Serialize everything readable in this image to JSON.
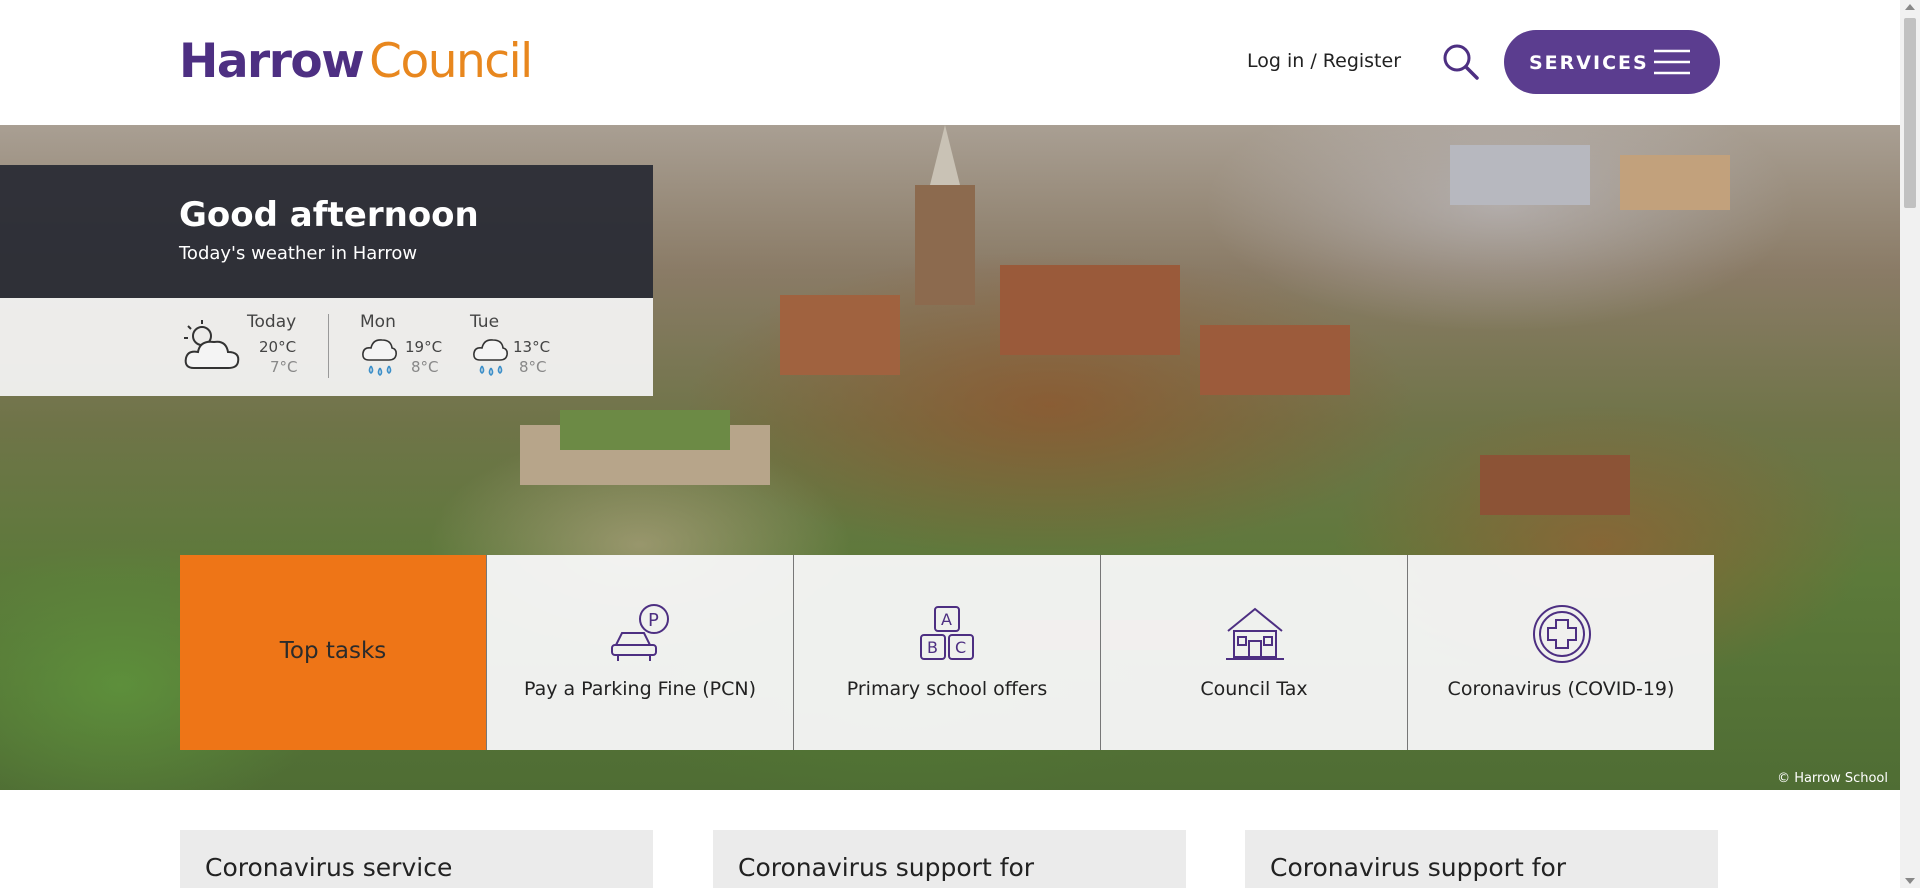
{
  "header": {
    "logo_primary": "Harrow",
    "logo_secondary": "Council",
    "login_label": "Log in / Register",
    "services_label": "SERVICES"
  },
  "hero": {
    "greeting": "Good afternoon",
    "weather_subtitle": "Today's weather in Harrow",
    "image_credit": "© Harrow School",
    "weather": [
      {
        "day": "Today",
        "high": "20°C",
        "low": "7°C",
        "icon": "partly-cloudy-icon"
      },
      {
        "day": "Mon",
        "high": "19°C",
        "low": "8°C",
        "icon": "rain-icon"
      },
      {
        "day": "Tue",
        "high": "13°C",
        "low": "8°C",
        "icon": "rain-icon"
      }
    ]
  },
  "top_tasks": {
    "title": "Top tasks",
    "items": [
      {
        "label": "Pay a Parking Fine (PCN)",
        "icon": "parking-car-icon"
      },
      {
        "label": "Primary school offers",
        "icon": "abc-blocks-icon"
      },
      {
        "label": "Council Tax",
        "icon": "house-icon"
      },
      {
        "label": "Coronavirus (COVID-19)",
        "icon": "medical-cross-icon"
      }
    ]
  },
  "cards": [
    {
      "title": "Coronavirus service"
    },
    {
      "title": "Coronavirus support for"
    },
    {
      "title": "Coronavirus support for"
    }
  ],
  "colors": {
    "brand_purple": "#4d2f82",
    "brand_orange": "#e8871e",
    "services_button": "#5b3d8f",
    "top_tasks_orange": "#ee7517",
    "weather_rain": "#3c8fc9"
  }
}
